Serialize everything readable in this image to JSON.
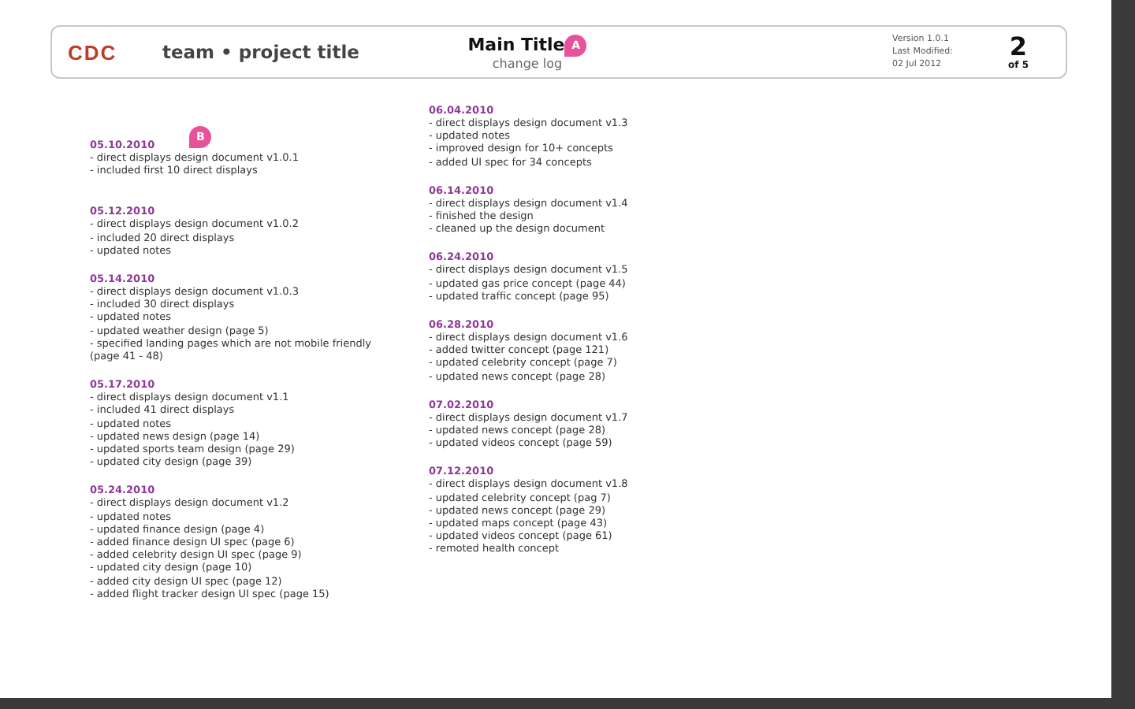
{
  "header": {
    "logo": "CDC",
    "project": "team • project title",
    "title": "Main Title",
    "subtitle": "change log",
    "title_marker": "A",
    "version": "Version 1.0.1",
    "modified_label": "Last Modified:",
    "modified_date": "02 Jul 2012",
    "page": "2",
    "page_of": "of 5"
  },
  "columns": [
    {
      "entries": [
        {
          "date": "05.10.2010",
          "marker": "B",
          "lines": [
            "- direct displays design document v1.0.1",
            "- included first 10 direct displays"
          ]
        },
        {
          "date": "05.12.2010",
          "lines": [
            "- direct displays design document v1.0.2",
            "- included 20 direct displays",
            "- updated notes"
          ]
        },
        {
          "date": "05.14.2010",
          "lines": [
            "- direct displays design document v1.0.3",
            "- included 30 direct displays",
            "- updated notes",
            "- updated weather design (page 5)",
            "- specified landing pages which are not mobile friendly (page 41 - 48)"
          ]
        },
        {
          "date": "05.17.2010",
          "lines": [
            "- direct displays design document v1.1",
            "- included 41 direct displays",
            "- updated notes",
            "- updated news design (page 14)",
            "- updated sports team design (page 29)",
            "- updated city design (page 39)"
          ]
        },
        {
          "date": "05.24.2010",
          "lines": [
            "- direct displays design document v1.2",
            "- updated notes",
            "- updated finance design (page 4)",
            "- added finance design UI spec (page 6)",
            "- added celebrity design UI spec (page 9)",
            "- updated city design (page 10)",
            "- added city design UI spec (page 12)",
            "- added flight tracker design UI spec (page 15)"
          ]
        }
      ]
    },
    {
      "entries": [
        {
          "date": "06.04.2010",
          "lines": [
            "- direct displays design document v1.3",
            "- updated notes",
            "- improved design for 10+ concepts",
            "- added UI spec for 34 concepts"
          ]
        },
        {
          "date": "06.14.2010",
          "lines": [
            "- direct displays design document v1.4",
            "- finished the design",
            "- cleaned up the design document"
          ]
        },
        {
          "date": "06.24.2010",
          "lines": [
            "- direct displays design document v1.5",
            "- updated gas price concept (page 44)",
            "- updated traffic concept (page 95)"
          ]
        },
        {
          "date": "06.28.2010",
          "lines": [
            "- direct displays design document v1.6",
            "- added twitter concept (page 121)",
            "- updated celebrity concept (page 7)",
            "- updated news concept (page 28)"
          ]
        },
        {
          "date": "07.02.2010",
          "lines": [
            "- direct displays design document v1.7",
            "- updated news concept (page 28)",
            "- updated videos concept (page 59)"
          ]
        },
        {
          "date": "07.12.2010",
          "lines": [
            "- direct displays design document v1.8",
            "- updated celebrity concept (pag 7)",
            "- updated news concept (page 29)",
            "- updated maps concept (page 43)",
            "- updated videos concept (page 61)",
            "- remoted health concept"
          ]
        }
      ]
    }
  ]
}
